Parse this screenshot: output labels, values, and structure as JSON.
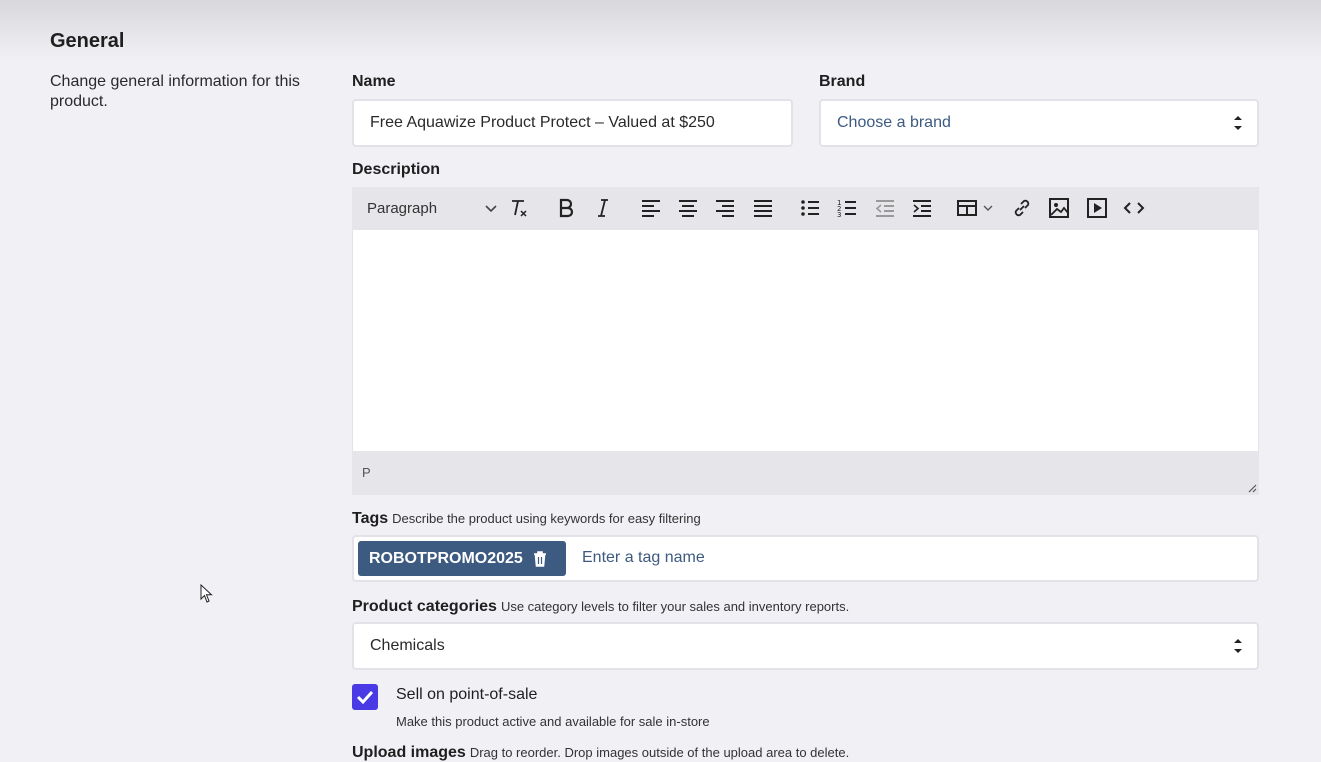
{
  "section": {
    "title": "General",
    "description": "Change general information for this product."
  },
  "name_field": {
    "label": "Name",
    "value": "Free Aquawize Product Protect – Valued at $250"
  },
  "brand_field": {
    "label": "Brand",
    "placeholder": "Choose a brand"
  },
  "description_field": {
    "label": "Description",
    "toolbar": {
      "block_format": "Paragraph",
      "icons": [
        "clear-formatting-icon",
        "bold-icon",
        "italic-icon",
        "align-left-icon",
        "align-center-icon",
        "align-right-icon",
        "align-justify-icon",
        "bullet-list-icon",
        "numbered-list-icon",
        "outdent-icon",
        "indent-icon",
        "table-icon",
        "link-icon",
        "image-icon",
        "media-icon",
        "source-code-icon"
      ]
    },
    "status_path": "P"
  },
  "tags_field": {
    "label": "Tags",
    "hint": "Describe the product using keywords for easy filtering",
    "tags": [
      "ROBOTPROMO2025"
    ],
    "placeholder": "Enter a tag name"
  },
  "categories_field": {
    "label": "Product categories",
    "hint": "Use category levels to filter your sales and inventory reports.",
    "value": "Chemicals"
  },
  "pos_checkbox": {
    "checked": true,
    "label": "Sell on point-of-sale",
    "hint": "Make this product active and available for sale in-store"
  },
  "upload_images": {
    "label": "Upload images",
    "hint": "Drag to reorder. Drop images outside of the upload area to delete."
  },
  "colors": {
    "accent": "#4a3ae6",
    "tag_chip": "#3d5a80",
    "background": "#f0f0f5"
  }
}
